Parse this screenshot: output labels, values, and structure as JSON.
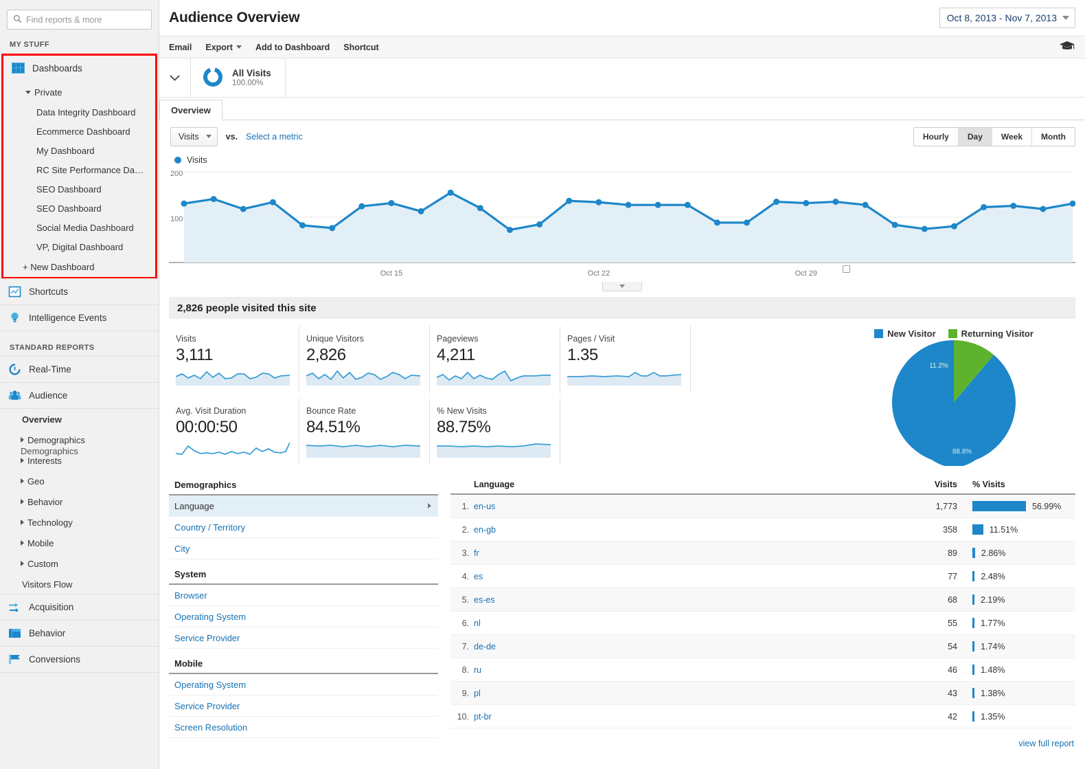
{
  "search": {
    "placeholder": "Find reports & more",
    "value": ""
  },
  "sidebar": {
    "my_stuff_label": "MY STUFF",
    "standard_reports_label": "STANDARD REPORTS",
    "dashboards_label": "Dashboards",
    "private_label": "Private",
    "dashboard_items": [
      "Data Integrity Dashboard",
      "Ecommerce Dashboard",
      "My Dashboard",
      "RC Site Performance Da…",
      "SEO Dashboard",
      "SEO Dashboard",
      "Social Media Dashboard",
      "VP, Digital Dashboard"
    ],
    "new_dashboard_label": "+ New Dashboard",
    "shortcuts_label": "Shortcuts",
    "intelligence_label": "Intelligence Events",
    "realtime_label": "Real-Time",
    "audience_label": "Audience",
    "audience_sub": [
      "Overview",
      "Demographics",
      "Interests",
      "Geo",
      "Behavior",
      "Technology",
      "Mobile",
      "Custom",
      "Visitors Flow"
    ],
    "ghost_label": "Demographics",
    "acquisition_label": "Acquisition",
    "behavior_label": "Behavior",
    "conversions_label": "Conversions",
    "highlight_color": "#ff0000"
  },
  "header": {
    "title": "Audience Overview",
    "date_range": "Oct 8, 2013 - Nov 7, 2013"
  },
  "toolbar": {
    "email": "Email",
    "export": "Export",
    "add_to_dashboard": "Add to Dashboard",
    "shortcut": "Shortcut"
  },
  "segment": {
    "name": "All Visits",
    "percent": "100.00%"
  },
  "tabs": [
    {
      "label": "Overview",
      "active": true
    }
  ],
  "metric_selector": {
    "metric": "Visits",
    "vs_label": "vs.",
    "select_metric": "Select a metric",
    "granularity": [
      "Hourly",
      "Day",
      "Week",
      "Month"
    ],
    "granularity_active": "Day"
  },
  "banner": "2,826 people visited this site",
  "stats": [
    {
      "label": "Visits",
      "value": "3,111"
    },
    {
      "label": "Unique Visitors",
      "value": "2,826"
    },
    {
      "label": "Pageviews",
      "value": "4,211"
    },
    {
      "label": "Pages / Visit",
      "value": "1.35"
    },
    {
      "label": "Avg. Visit Duration",
      "value": "00:00:50"
    },
    {
      "label": "Bounce Rate",
      "value": "84.51%"
    },
    {
      "label": "% New Visits",
      "value": "88.75%"
    }
  ],
  "demographics_panel": {
    "sections": [
      {
        "header": "Demographics",
        "items": [
          "Language",
          "Country / Territory",
          "City"
        ]
      },
      {
        "header": "System",
        "items": [
          "Browser",
          "Operating System",
          "Service Provider"
        ]
      },
      {
        "header": "Mobile",
        "items": [
          "Operating System",
          "Service Provider",
          "Screen Resolution"
        ]
      }
    ],
    "selected": "Language"
  },
  "language_table": {
    "columns": [
      "Language",
      "Visits",
      "% Visits"
    ],
    "rows": [
      {
        "index": "1.",
        "name": "en-us",
        "visits": "1,773",
        "pct": "56.99%",
        "pct_value": 56.99
      },
      {
        "index": "2.",
        "name": "en-gb",
        "visits": "358",
        "pct": "11.51%",
        "pct_value": 11.51
      },
      {
        "index": "3.",
        "name": "fr",
        "visits": "89",
        "pct": "2.86%",
        "pct_value": 2.86
      },
      {
        "index": "4.",
        "name": "es",
        "visits": "77",
        "pct": "2.48%",
        "pct_value": 2.48
      },
      {
        "index": "5.",
        "name": "es-es",
        "visits": "68",
        "pct": "2.19%",
        "pct_value": 2.19
      },
      {
        "index": "6.",
        "name": "nl",
        "visits": "55",
        "pct": "1.77%",
        "pct_value": 1.77
      },
      {
        "index": "7.",
        "name": "de-de",
        "visits": "54",
        "pct": "1.74%",
        "pct_value": 1.74
      },
      {
        "index": "8.",
        "name": "ru",
        "visits": "46",
        "pct": "1.48%",
        "pct_value": 1.48
      },
      {
        "index": "9.",
        "name": "pl",
        "visits": "43",
        "pct": "1.38%",
        "pct_value": 1.38
      },
      {
        "index": "10.",
        "name": "pt-br",
        "visits": "42",
        "pct": "1.35%",
        "pct_value": 1.35
      }
    ],
    "view_full_report": "view full report"
  },
  "colors": {
    "accent_blue": "#1d87c9",
    "line_fill": "#e3eff7",
    "new_visitor": "#1d87c9",
    "returning_visitor": "#5eb22e",
    "link": "#1772b4"
  },
  "chart_data": [
    {
      "type": "line",
      "title": "Visits",
      "legend": [
        "Visits"
      ],
      "legend_position": "top-left",
      "xlabel": "",
      "ylabel": "",
      "ylim": [
        0,
        200
      ],
      "yticks": [
        100,
        200
      ],
      "grid": true,
      "x_tick_labels": [
        "Oct 15",
        "Oct 22",
        "Oct 29"
      ],
      "x_tick_positions": [
        7,
        14,
        21
      ],
      "x": [
        "Oct 8",
        "Oct 9",
        "Oct 10",
        "Oct 11",
        "Oct 12",
        "Oct 13",
        "Oct 14",
        "Oct 15",
        "Oct 16",
        "Oct 17",
        "Oct 18",
        "Oct 19",
        "Oct 20",
        "Oct 21",
        "Oct 22",
        "Oct 23",
        "Oct 24",
        "Oct 25",
        "Oct 26",
        "Oct 27",
        "Oct 28",
        "Oct 29",
        "Oct 30",
        "Oct 31",
        "Nov 1",
        "Nov 2",
        "Nov 3",
        "Nov 4",
        "Nov 5",
        "Nov 6",
        "Nov 7"
      ],
      "values": [
        130,
        140,
        118,
        133,
        82,
        76,
        124,
        131,
        113,
        154,
        120,
        72,
        84,
        136,
        133,
        127,
        127,
        127,
        88,
        88,
        134,
        131,
        134,
        127,
        83,
        74,
        80,
        122,
        125,
        118,
        130
      ]
    },
    {
      "type": "pie",
      "title": "",
      "legend": [
        "New Visitor",
        "Returning Visitor"
      ],
      "legend_position": "top",
      "labels": [
        "New Visitor",
        "Returning Visitor"
      ],
      "values": [
        88.8,
        11.2
      ],
      "value_labels": [
        "88.8%",
        "11.2%"
      ],
      "colors": [
        "#1d87c9",
        "#5eb22e"
      ]
    }
  ]
}
